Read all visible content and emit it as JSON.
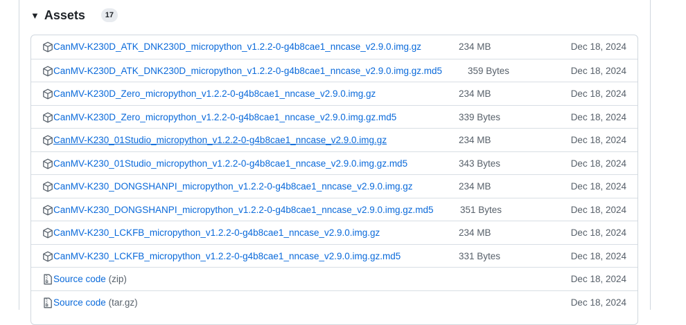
{
  "assets": {
    "title": "Assets",
    "count": "17",
    "rows": [
      {
        "name": "CanMV-K230D_ATK_DNK230D_micropython_v1.2.2-0-g4b8cae1_nncase_v2.9.0.img.gz",
        "size": "234 MB",
        "date": "Dec 18, 2024"
      },
      {
        "name": "CanMV-K230D_ATK_DNK230D_micropython_v1.2.2-0-g4b8cae1_nncase_v2.9.0.img.gz.md5",
        "size": "359 Bytes",
        "date": "Dec 18, 2024"
      },
      {
        "name": "CanMV-K230D_Zero_micropython_v1.2.2-0-g4b8cae1_nncase_v2.9.0.img.gz",
        "size": "234 MB",
        "date": "Dec 18, 2024"
      },
      {
        "name": "CanMV-K230D_Zero_micropython_v1.2.2-0-g4b8cae1_nncase_v2.9.0.img.gz.md5",
        "size": "339 Bytes",
        "date": "Dec 18, 2024"
      },
      {
        "name": "CanMV-K230_01Studio_micropython_v1.2.2-0-g4b8cae1_nncase_v2.9.0.img.gz",
        "size": "234 MB",
        "date": "Dec 18, 2024"
      },
      {
        "name": "CanMV-K230_01Studio_micropython_v1.2.2-0-g4b8cae1_nncase_v2.9.0.img.gz.md5",
        "size": "343 Bytes",
        "date": "Dec 18, 2024"
      },
      {
        "name": "CanMV-K230_DONGSHANPI_micropython_v1.2.2-0-g4b8cae1_nncase_v2.9.0.img.gz",
        "size": "234 MB",
        "date": "Dec 18, 2024"
      },
      {
        "name": "CanMV-K230_DONGSHANPI_micropython_v1.2.2-0-g4b8cae1_nncase_v2.9.0.img.gz.md5",
        "size": "351 Bytes",
        "date": "Dec 18, 2024"
      },
      {
        "name": "CanMV-K230_LCKFB_micropython_v1.2.2-0-g4b8cae1_nncase_v2.9.0.img.gz",
        "size": "234 MB",
        "date": "Dec 18, 2024"
      },
      {
        "name": "CanMV-K230_LCKFB_micropython_v1.2.2-0-g4b8cae1_nncase_v2.9.0.img.gz.md5",
        "size": "331 Bytes",
        "date": "Dec 18, 2024"
      }
    ],
    "source": [
      {
        "label": "Source code",
        "ext": "(zip)",
        "date": "Dec 18, 2024"
      },
      {
        "label": "Source code",
        "ext": "(tar.gz)",
        "date": "Dec 18, 2024"
      }
    ]
  },
  "icons": {
    "package": "package-icon",
    "zip": "file-zip-icon",
    "caret": "triangle-down-icon"
  },
  "colors": {
    "link": "#0969da",
    "muted": "#57606a",
    "border": "#d0d7de"
  }
}
